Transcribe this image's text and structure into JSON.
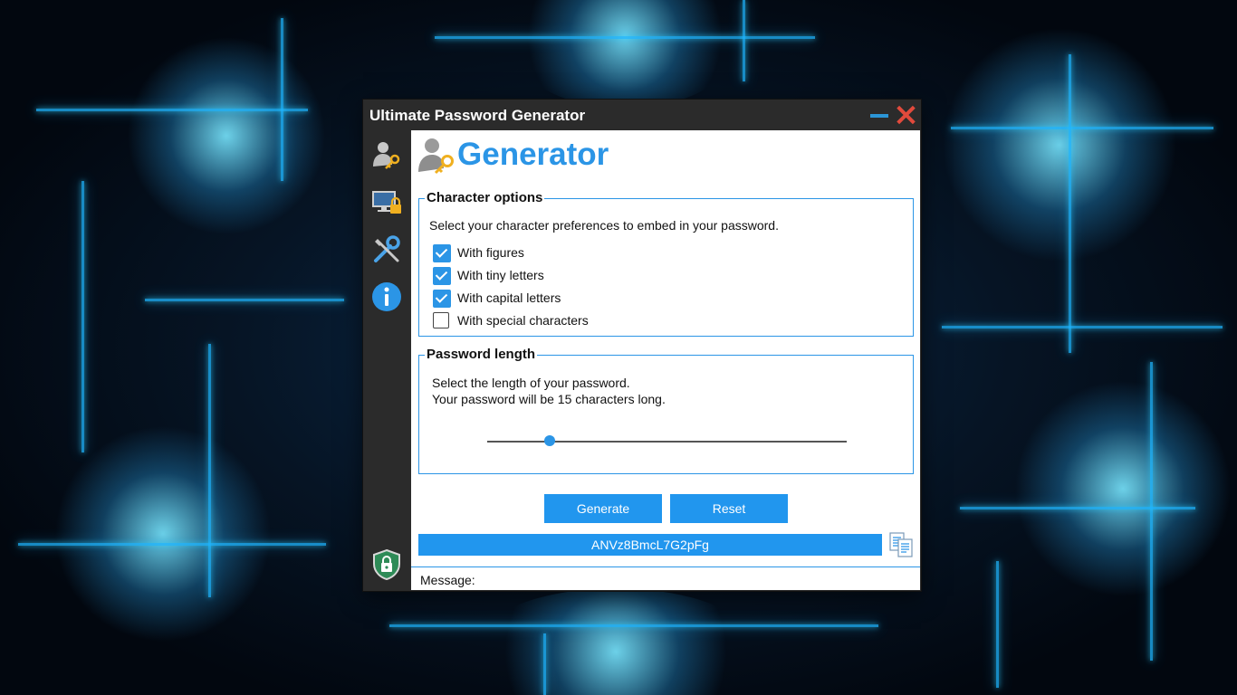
{
  "window": {
    "title": "Ultimate Password Generator"
  },
  "sidebar": {
    "items": [
      {
        "icon": "user-key-icon"
      },
      {
        "icon": "monitor-lock-icon"
      },
      {
        "icon": "wrench-screwdriver-icon"
      },
      {
        "icon": "info-icon"
      }
    ],
    "footer_icon": "shield-lock-icon"
  },
  "header": {
    "title": "Generator",
    "icon": "user-key-icon"
  },
  "character_options": {
    "legend": "Character options",
    "description": "Select your character preferences to embed in your password.",
    "options": [
      {
        "label": "With figures",
        "checked": true
      },
      {
        "label": "With tiny letters",
        "checked": true
      },
      {
        "label": "With capital letters",
        "checked": true
      },
      {
        "label": "With special characters",
        "checked": false
      }
    ]
  },
  "password_length": {
    "legend": "Password length",
    "line1": "Select the length of your password.",
    "line2": "Your password will be 15 characters long.",
    "value": 15
  },
  "actions": {
    "generate_label": "Generate",
    "reset_label": "Reset"
  },
  "output": {
    "password": "ANVz8BmcL7G2pFg",
    "copy_icon": "copy-icon"
  },
  "status": {
    "message_label": "Message:"
  },
  "colors": {
    "accent": "#2b95e6",
    "sidebar": "#2b2b2b",
    "close": "#e24a3c"
  }
}
